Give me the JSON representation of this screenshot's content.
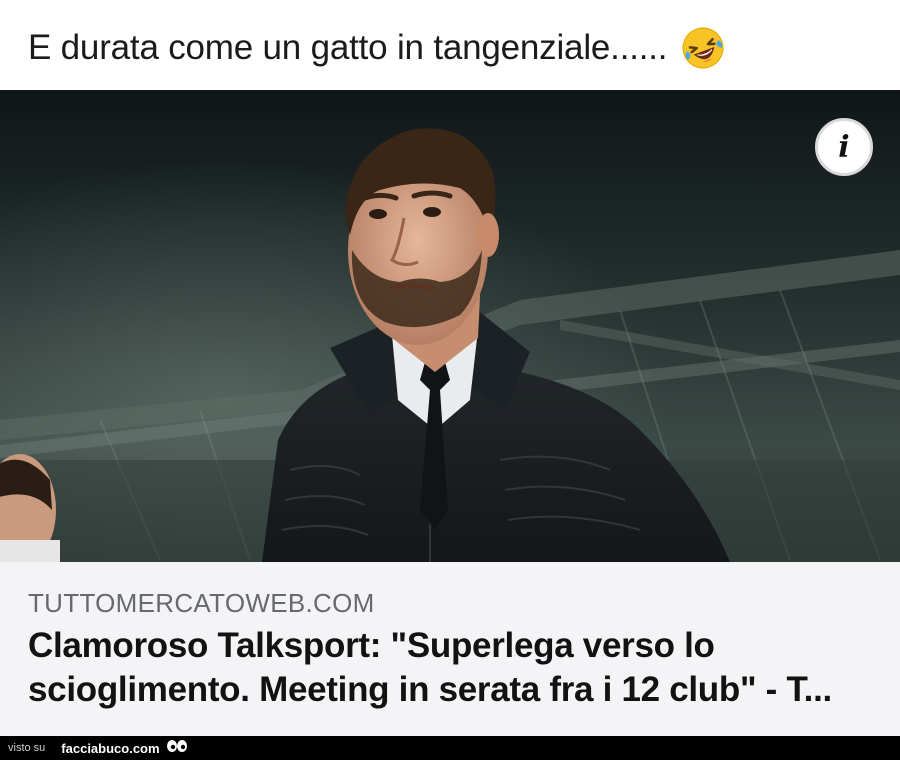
{
  "post": {
    "text": "E durata come un gatto in tangenziale......",
    "emoji": "rolling-on-floor-laughing-emoji"
  },
  "photo": {
    "info_label": "i"
  },
  "article": {
    "source": "TUTTOMERCATOWEB.COM",
    "headline": "Clamoroso Talksport: \"Superlega verso lo scioglimento. Meeting in serata fra i 12 club\" - T..."
  },
  "footer": {
    "visto_su": "visto su",
    "brand": "facciabuco.com"
  },
  "colors": {
    "caption_bg": "#f4f4f6",
    "source_text": "#666a70",
    "headline_text": "#121212",
    "footer_bg": "#000000"
  }
}
